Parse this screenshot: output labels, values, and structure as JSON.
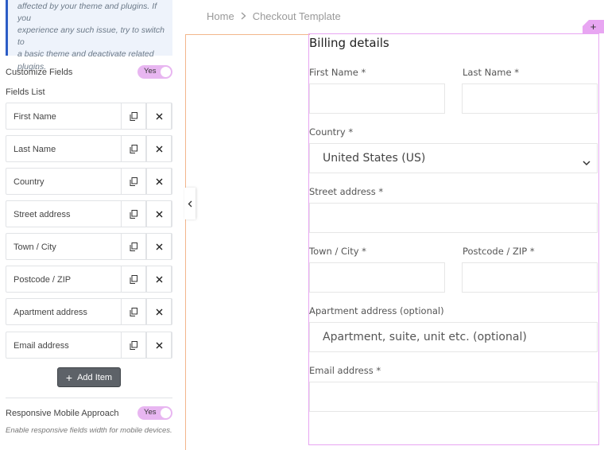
{
  "sidebar": {
    "notice_lines": [
      "affected by your theme and plugins. If you",
      "experience any such issue, try to switch to",
      "a basic theme and deactivate related",
      "plugins."
    ],
    "customize_fields_label": "Customize Fields",
    "customize_fields_toggle": "Yes",
    "fields_list_label": "Fields List",
    "fields": [
      "First Name",
      "Last Name",
      "Country",
      "Street address",
      "Town / City",
      "Postcode / ZIP",
      "Apartment address",
      "Email address"
    ],
    "add_item_label": "Add Item",
    "responsive_label": "Responsive Mobile Approach",
    "responsive_toggle": "Yes",
    "responsive_hint": "Enable responsive fields width for mobile devices."
  },
  "preview": {
    "breadcrumb": {
      "home": "Home",
      "separator": ">",
      "current": "Checkout Template"
    },
    "add_section_symbol": "+",
    "heading": "Billing details",
    "labels": {
      "first_name": "First Name *",
      "last_name": "Last Name *",
      "country": "Country *",
      "street": "Street address *",
      "town": "Town / City *",
      "postcode": "Postcode / ZIP *",
      "apartment": "Apartment address (optional)",
      "email": "Email address *"
    },
    "country_value": "United States (US)",
    "apartment_placeholder": "Apartment, suite, unit etc. (optional)"
  },
  "colors": {
    "accent_pink": "#e8a6f2",
    "toggle_pink": "#e8b6f1",
    "notice_blue": "#2b5cc6",
    "add_button": "#5d6268",
    "guide_orange": "#f2b68c"
  },
  "icons": [
    "copy-icon",
    "close-icon",
    "plus-icon",
    "chevron-left-icon",
    "chevron-down-icon",
    "chevron-right-icon"
  ]
}
